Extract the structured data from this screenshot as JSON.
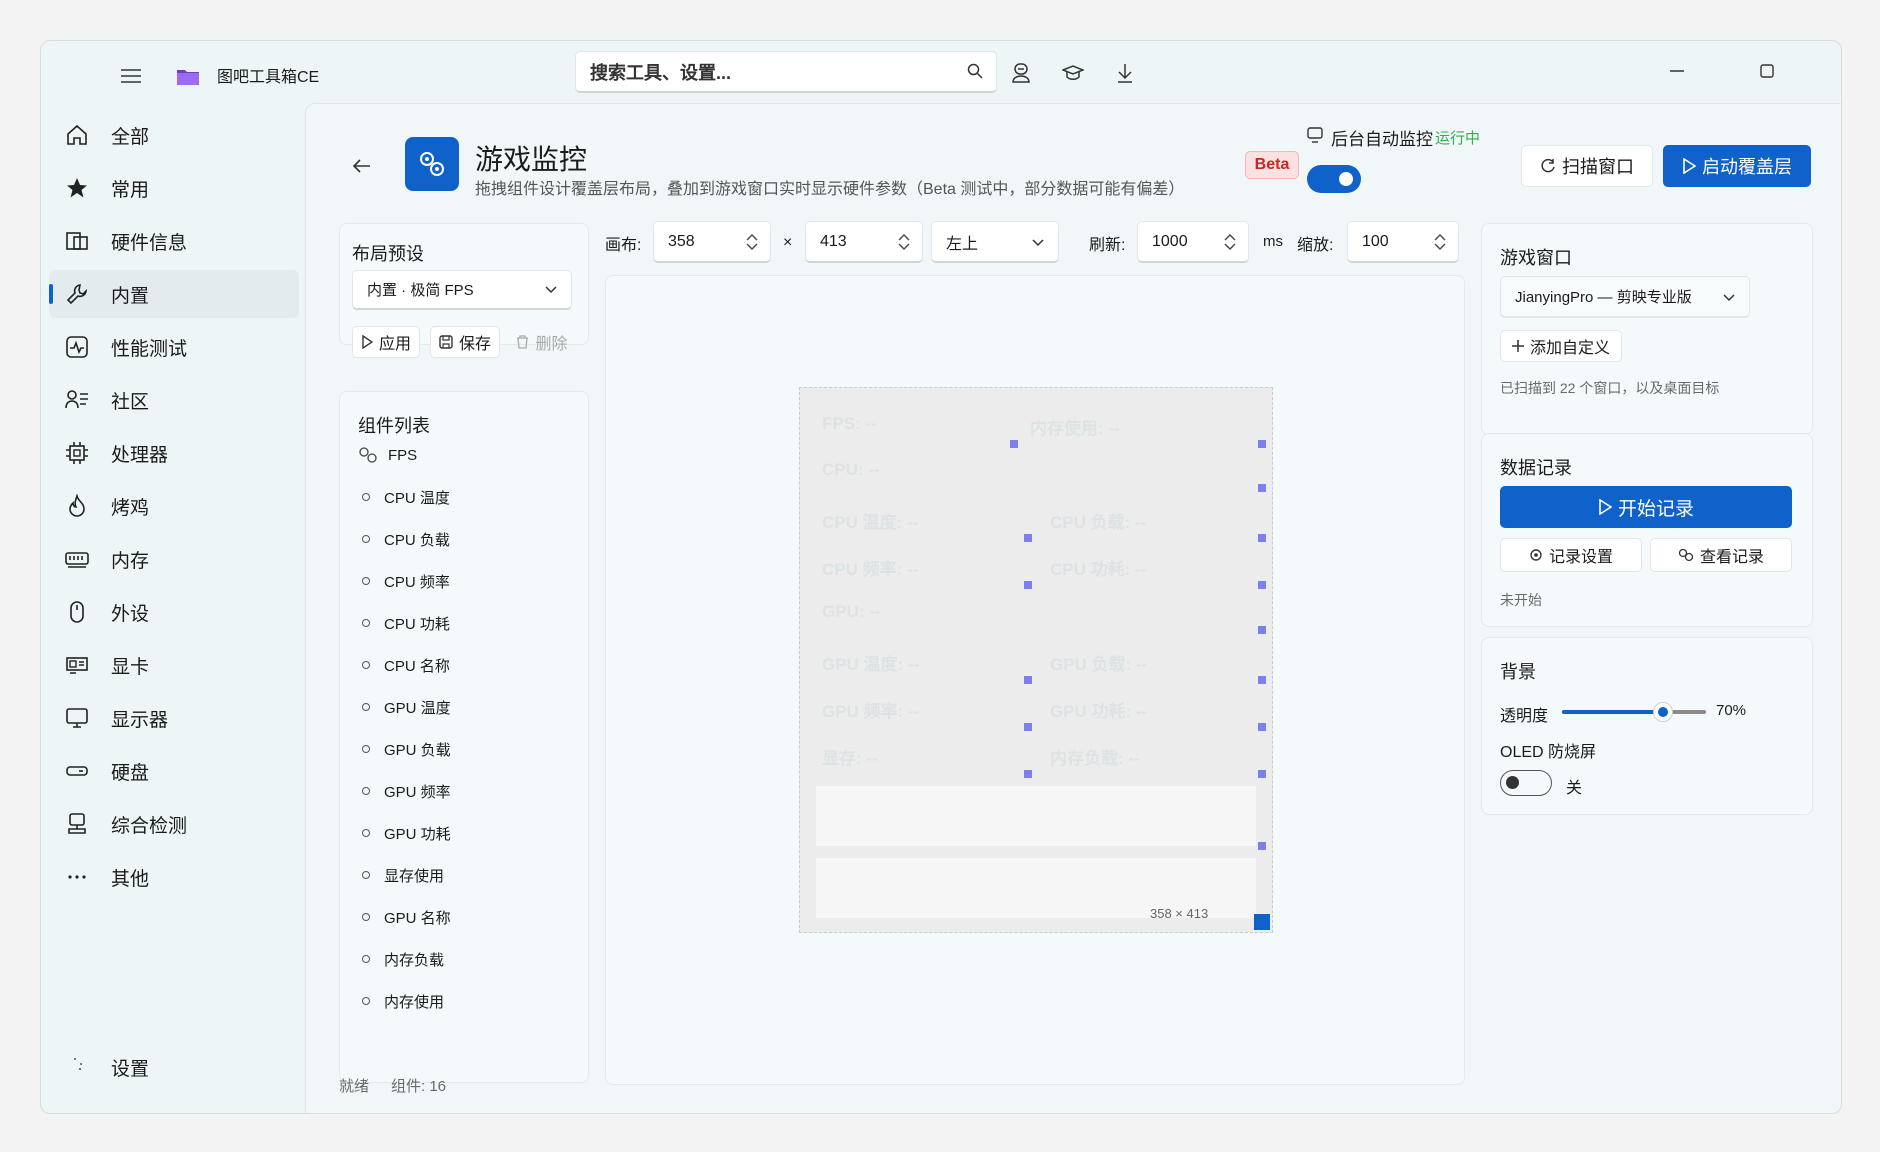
{
  "app": {
    "title": "图吧工具箱CE"
  },
  "search": {
    "placeholder": "搜索工具、设置..."
  },
  "nav": {
    "items": [
      {
        "label": "全部",
        "icon": "home-icon"
      },
      {
        "label": "常用",
        "icon": "star-icon"
      },
      {
        "label": "硬件信息",
        "icon": "hardware-info-icon"
      },
      {
        "label": "内置",
        "icon": "wrench-icon"
      },
      {
        "label": "性能测试",
        "icon": "pulse-icon"
      },
      {
        "label": "社区",
        "icon": "community-icon"
      },
      {
        "label": "处理器",
        "icon": "cpu-icon"
      },
      {
        "label": "烤鸡",
        "icon": "flame-icon"
      },
      {
        "label": "内存",
        "icon": "memory-icon"
      },
      {
        "label": "外设",
        "icon": "mouse-icon"
      },
      {
        "label": "显卡",
        "icon": "gpu-icon"
      },
      {
        "label": "显示器",
        "icon": "monitor-icon"
      },
      {
        "label": "硬盘",
        "icon": "disk-icon"
      },
      {
        "label": "综合检测",
        "icon": "diagnostics-icon"
      },
      {
        "label": "其他",
        "icon": "more-icon"
      }
    ],
    "settings_label": "设置"
  },
  "header": {
    "title": "游戏监控",
    "subtitle": "拖拽组件设计覆盖层布局，叠加到游戏窗口实时显示硬件参数（Beta 测试中，部分数据可能有偏差）",
    "badge": "Beta",
    "auto_monitor_label": "后台自动监控",
    "auto_monitor_status": "运行中",
    "scan_button": "扫描窗口",
    "start_overlay_button": "启动覆盖层"
  },
  "presets": {
    "title": "布局预设",
    "selected": "内置 · 极简 FPS",
    "apply": "应用",
    "save": "保存",
    "delete": "删除"
  },
  "components": {
    "title": "组件列表",
    "items": [
      "FPS",
      "CPU 温度",
      "CPU 负载",
      "CPU 频率",
      "CPU 功耗",
      "CPU 名称",
      "GPU 温度",
      "GPU 负载",
      "GPU 频率",
      "GPU 功耗",
      "显存使用",
      "GPU 名称",
      "内存负载",
      "内存使用"
    ]
  },
  "toolbar": {
    "canvas_label": "画布:",
    "width": "358",
    "times": "×",
    "height": "413",
    "anchor": "左上",
    "refresh_label": "刷新:",
    "refresh": "1000",
    "ms": "ms",
    "zoom_label": "缩放:",
    "zoom": "100"
  },
  "canvas": {
    "widgets": [
      "FPS: --",
      "内存使用: --",
      "CPU: --",
      "CPU 温度: --",
      "CPU 负载: --",
      "CPU 频率: --",
      "CPU 功耗: --",
      "GPU: --",
      "GPU 温度: --",
      "GPU 负载: --",
      "GPU 频率: --",
      "GPU 功耗: --",
      "显存: --",
      "内存负载: --"
    ],
    "size_label": "358 × 413"
  },
  "game_window": {
    "title": "游戏窗口",
    "selected": "JianyingPro — 剪映专业版",
    "add_custom": "添加自定义",
    "scan_info": "已扫描到 22 个窗口，以及桌面目标"
  },
  "recording": {
    "title": "数据记录",
    "start": "开始记录",
    "settings": "记录设置",
    "view": "查看记录",
    "status": "未开始"
  },
  "background": {
    "title": "背景",
    "opacity_label": "透明度",
    "opacity_value": "70%",
    "opacity_level": 0.7,
    "oled_label": "OLED 防烧屏",
    "oled_state": "关"
  },
  "status_bar": {
    "ready": "就绪",
    "count": "组件: 16"
  },
  "colors": {
    "accent": "#0f62c9",
    "running": "#2bb24c",
    "beta": "#c62828"
  }
}
